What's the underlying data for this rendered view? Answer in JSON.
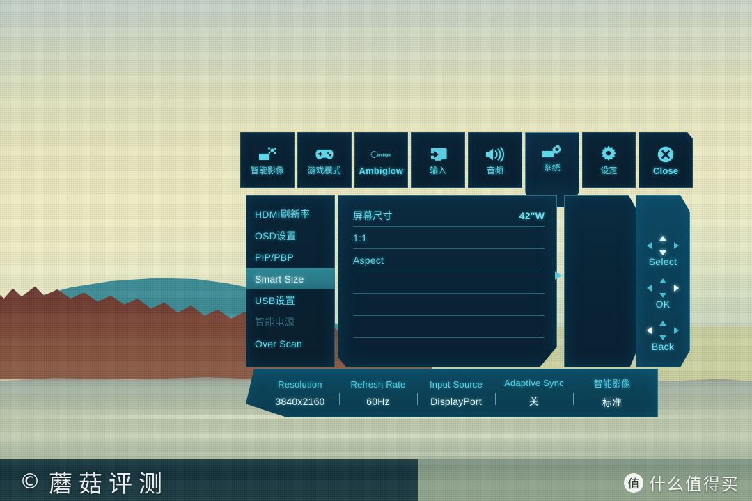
{
  "watermarks": {
    "left_copyright": "©",
    "left_text": "蘑菇评测",
    "right_badge": "值",
    "right_text": "什么值得买"
  },
  "osd": {
    "tabs": [
      {
        "label": "智能影像",
        "icon": "smart-image-icon",
        "active": false,
        "latin": false
      },
      {
        "label": "游戏模式",
        "icon": "gamepad-icon",
        "active": false,
        "latin": false
      },
      {
        "label": "Ambiglow",
        "icon": "ambiglow-icon",
        "active": false,
        "latin": true
      },
      {
        "label": "输入",
        "icon": "input-source-icon",
        "active": false,
        "latin": false
      },
      {
        "label": "音频",
        "icon": "speaker-icon",
        "active": false,
        "latin": false
      },
      {
        "label": "系统",
        "icon": "system-gear-icon",
        "active": true,
        "latin": false
      },
      {
        "label": "设定",
        "icon": "settings-gear-icon",
        "active": false,
        "latin": false
      },
      {
        "label": "Close",
        "icon": "close-circle-icon",
        "active": false,
        "latin": true
      }
    ],
    "menu_items": [
      {
        "label": "HDMI刷新率",
        "selected": false,
        "disabled": false
      },
      {
        "label": "OSD设置",
        "selected": false,
        "disabled": false
      },
      {
        "label": "PIP/PBP",
        "selected": false,
        "disabled": false
      },
      {
        "label": "Smart Size",
        "selected": true,
        "disabled": false
      },
      {
        "label": "USB设置",
        "selected": false,
        "disabled": false
      },
      {
        "label": "智能电源",
        "selected": false,
        "disabled": true
      },
      {
        "label": "Over Scan",
        "selected": false,
        "disabled": false
      }
    ],
    "option_rows": [
      {
        "label": "屏幕尺寸",
        "value": "42\"W"
      },
      {
        "label": "1:1",
        "value": ""
      },
      {
        "label": "Aspect",
        "value": ""
      },
      {
        "label": "",
        "value": ""
      },
      {
        "label": "",
        "value": ""
      },
      {
        "label": "",
        "value": ""
      }
    ],
    "nav": [
      {
        "label": "Select",
        "highlight": "vertical"
      },
      {
        "label": "OK",
        "highlight": "right"
      },
      {
        "label": "Back",
        "highlight": "left"
      }
    ],
    "status": [
      {
        "key": "Resolution",
        "value": "3840x2160"
      },
      {
        "key": "Refresh Rate",
        "value": "60Hz"
      },
      {
        "key": "Input Source",
        "value": "DisplayPort"
      },
      {
        "key": "Adaptive Sync",
        "value": "关"
      },
      {
        "key": "智能影像",
        "value": "标准"
      }
    ]
  },
  "colors": {
    "accent_cyan": "#5fd6e8",
    "panel_dark": "#0a2334",
    "panel_teal": "#0c4257",
    "selection_teal": "#2f8795"
  }
}
